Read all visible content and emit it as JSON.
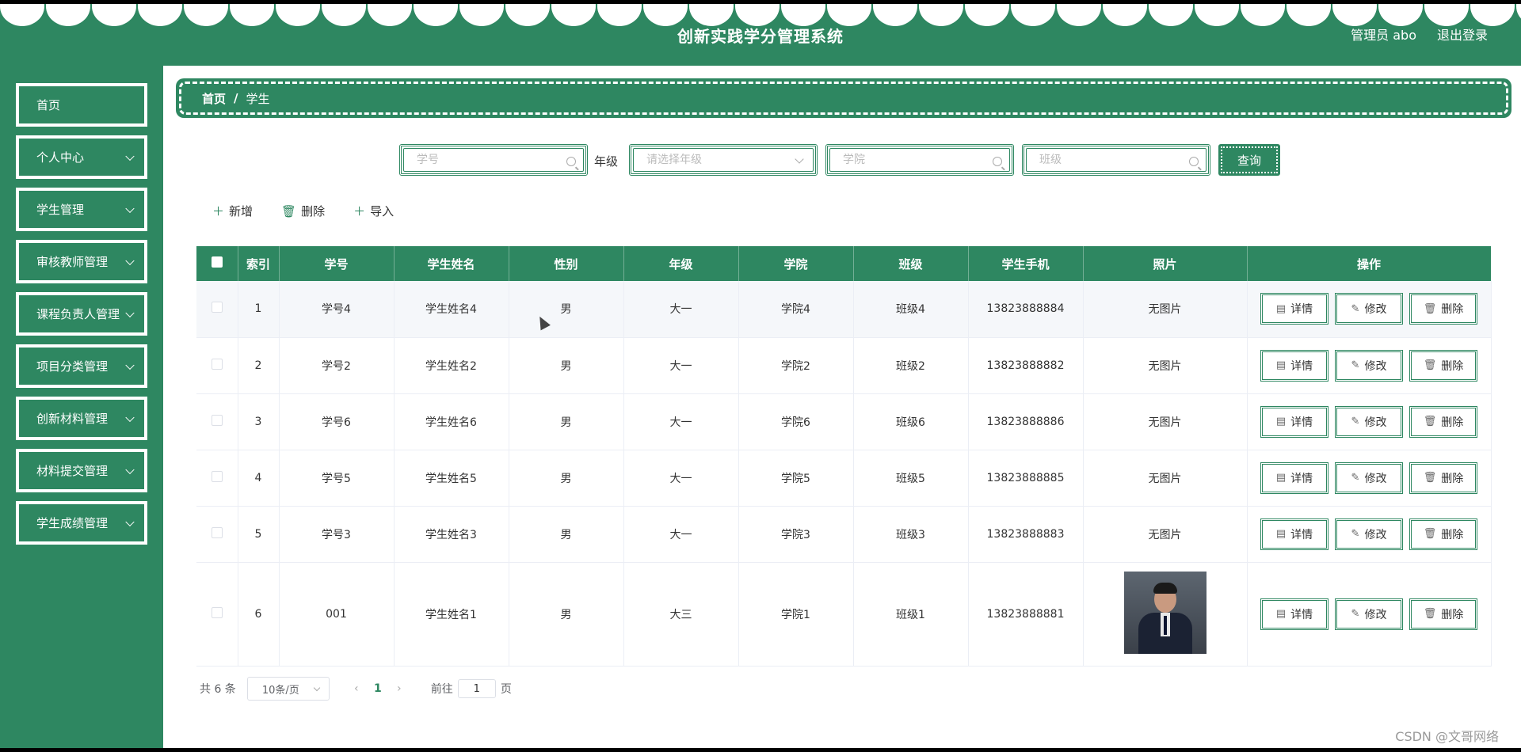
{
  "header": {
    "title": "创新实践学分管理系统",
    "user": "管理员 abo",
    "logout": "退出登录"
  },
  "sidebar": {
    "items": [
      {
        "label": "首页",
        "has_children": false
      },
      {
        "label": "个人中心",
        "has_children": true
      },
      {
        "label": "学生管理",
        "has_children": true
      },
      {
        "label": "审核教师管理",
        "has_children": true
      },
      {
        "label": "课程负责人管理",
        "has_children": true
      },
      {
        "label": "项目分类管理",
        "has_children": true
      },
      {
        "label": "创新材料管理",
        "has_children": true
      },
      {
        "label": "材料提交管理",
        "has_children": true
      },
      {
        "label": "学生成绩管理",
        "has_children": true
      }
    ]
  },
  "breadcrumb": {
    "home": "首页",
    "separator": "/",
    "current": "学生"
  },
  "search": {
    "student_no_placeholder": "学号",
    "grade_label": "年级",
    "grade_placeholder": "请选择年级",
    "college_placeholder": "学院",
    "class_placeholder": "班级",
    "query_label": "查询"
  },
  "actions": {
    "add": "新增",
    "delete": "删除",
    "import": "导入"
  },
  "table": {
    "headers": [
      "索引",
      "学号",
      "学生姓名",
      "性别",
      "年级",
      "学院",
      "班级",
      "学生手机",
      "照片",
      "操作"
    ],
    "op_labels": {
      "detail": "详情",
      "edit": "修改",
      "delete": "删除"
    },
    "rows": [
      {
        "index": "1",
        "no": "学号4",
        "name": "学生姓名4",
        "gender": "男",
        "grade": "大一",
        "college": "学院4",
        "class": "班级4",
        "phone": "13823888884",
        "photo": "无图片"
      },
      {
        "index": "2",
        "no": "学号2",
        "name": "学生姓名2",
        "gender": "男",
        "grade": "大一",
        "college": "学院2",
        "class": "班级2",
        "phone": "13823888882",
        "photo": "无图片"
      },
      {
        "index": "3",
        "no": "学号6",
        "name": "学生姓名6",
        "gender": "男",
        "grade": "大一",
        "college": "学院6",
        "class": "班级6",
        "phone": "13823888886",
        "photo": "无图片"
      },
      {
        "index": "4",
        "no": "学号5",
        "name": "学生姓名5",
        "gender": "男",
        "grade": "大一",
        "college": "学院5",
        "class": "班级5",
        "phone": "13823888885",
        "photo": "无图片"
      },
      {
        "index": "5",
        "no": "学号3",
        "name": "学生姓名3",
        "gender": "男",
        "grade": "大一",
        "college": "学院3",
        "class": "班级3",
        "phone": "13823888883",
        "photo": "无图片"
      },
      {
        "index": "6",
        "no": "001",
        "name": "学生姓名1",
        "gender": "男",
        "grade": "大三",
        "college": "学院1",
        "class": "班级1",
        "phone": "13823888881",
        "photo": ""
      }
    ]
  },
  "pagination": {
    "total": "共 6 条",
    "page_size": "10条/页",
    "current_page": "1",
    "goto_label": "前往",
    "goto_value": "1",
    "page_suffix": "页"
  },
  "watermark": "CSDN @文哥网络",
  "colors": {
    "primary": "#2e8761"
  }
}
